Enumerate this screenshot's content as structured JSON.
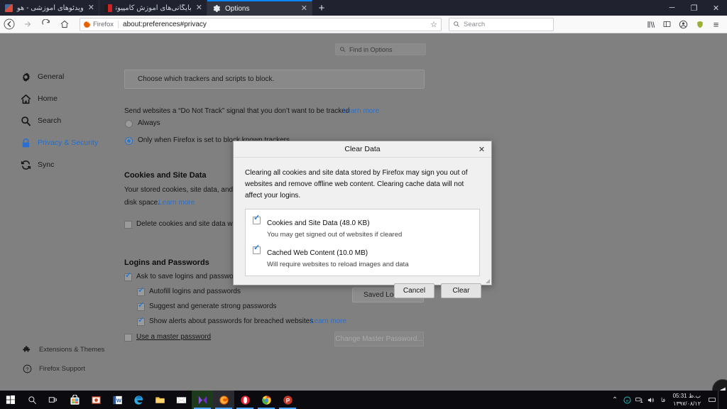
{
  "window": {
    "controls": {
      "minimize": "─",
      "maximize": "❐",
      "close": "✕"
    }
  },
  "tabs": [
    {
      "title": "ویدئوهای آموزشی - هوشیار",
      "close": "✕",
      "rtl": true,
      "active": false
    },
    {
      "title": "بایگانی‌های آموزش کامپیوتر - هود",
      "close": "✕",
      "rtl": true,
      "active": false
    },
    {
      "title": "Options",
      "close": "✕",
      "rtl": false,
      "active": true
    }
  ],
  "newtab_label": "+",
  "navbar": {
    "back": "←",
    "forward": "→",
    "reload": "↻",
    "home": "⌂",
    "identity_label": "Firefox",
    "url": "about:preferences#privacy",
    "bookmark_star": "☆",
    "search_placeholder": "Search",
    "icons": {
      "library": "library-icon",
      "sidebars": "sidebar-icon",
      "account": "account-icon",
      "shield": "shield-icon",
      "menu": "≡"
    }
  },
  "find_in_options": {
    "placeholder": "Find in Options",
    "icon": "search-icon"
  },
  "sidebar": {
    "items": [
      {
        "label": "General",
        "icon": "gear-icon",
        "selected": false
      },
      {
        "label": "Home",
        "icon": "home-icon",
        "selected": false
      },
      {
        "label": "Search",
        "icon": "search-icon",
        "selected": false
      },
      {
        "label": "Privacy & Security",
        "icon": "lock-icon",
        "selected": true
      },
      {
        "label": "Sync",
        "icon": "sync-icon",
        "selected": false
      }
    ],
    "footer": [
      {
        "label": "Extensions & Themes",
        "icon": "puzzle-icon"
      },
      {
        "label": "Firefox Support",
        "icon": "question-icon"
      }
    ]
  },
  "page": {
    "tracker_card": "Choose which trackers and scripts to block.",
    "dnt_text": "Send websites a “Do Not Track” signal that you don’t want to be tracked",
    "dnt_learn_more": "Learn more",
    "dnt_options": [
      {
        "label": "Always",
        "checked": false
      },
      {
        "label": "Only when Firefox is set to block known trackers",
        "checked": true
      }
    ],
    "cookies_heading": "Cookies and Site Data",
    "cookies_desc_line1": "Your stored cookies, site data, and cac",
    "cookies_desc_line2": "disk space.",
    "cookies_learn_more": "Learn more",
    "delete_cookies_label": "Delete cookies and site data when",
    "logins_heading": "Logins and Passwords",
    "logins_items": [
      {
        "label": "Ask to save logins and passwords",
        "checked": true
      },
      {
        "label": "Autofill logins and passwords",
        "checked": true
      },
      {
        "label": "Suggest and generate strong passwords",
        "checked": true
      },
      {
        "label": "Show alerts about passwords for breached websites",
        "checked": true
      }
    ],
    "breached_learn_more": "Learn more",
    "master_password_label": "Use a master password",
    "master_password_checked": false,
    "saved_logins_button": "Saved Logins...",
    "change_master_button": "Change Master Password..."
  },
  "dialog": {
    "title": "Clear Data",
    "close": "✕",
    "description": "Clearing all cookies and site data stored by Firefox may sign you out of websites and remove offline web content. Clearing cache data will not affect your logins.",
    "items": [
      {
        "label": "Cookies and Site Data (48.0 KB)",
        "sublabel": "You may get signed out of websites if cleared",
        "checked": true
      },
      {
        "label": "Cached Web Content (10.0 MB)",
        "sublabel": "Will require websites to reload images and data",
        "checked": true
      }
    ],
    "cancel_button": "Cancel",
    "clear_button": "Clear"
  },
  "page_side_button": {
    "icon": "chevron-left-icon",
    "glyph": "◀"
  },
  "taskbar": {
    "start": "start-icon",
    "search": "search-icon",
    "taskview": "task-view-icon",
    "apps": [
      {
        "name": "microsoft-store-icon"
      },
      {
        "name": "powerpoint-icon"
      },
      {
        "name": "word-icon"
      },
      {
        "name": "edge-icon"
      },
      {
        "name": "file-explorer-icon"
      },
      {
        "name": "mail-icon"
      },
      {
        "name": "media-player-icon"
      },
      {
        "name": "firefox-icon"
      },
      {
        "name": "opera-icon"
      },
      {
        "name": "chrome-icon"
      },
      {
        "name": "potplayer-icon"
      }
    ],
    "tray": {
      "chevron": "⌃",
      "icons": [
        "sync-tray-icon",
        "network-icon",
        "volume-icon",
        "keyboard-layout-icon"
      ],
      "keyboard": "فا",
      "time": "ب.ظ 05:31",
      "date": "۱۳۹۷/۰۸/۱۲"
    }
  }
}
